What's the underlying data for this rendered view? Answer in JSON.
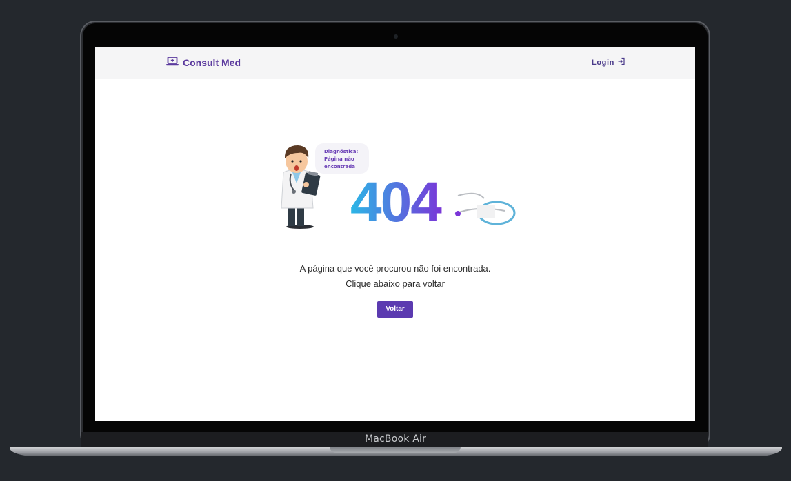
{
  "device": {
    "label": "MacBook Air"
  },
  "navbar": {
    "brand": "Consult Med",
    "login_label": "Login"
  },
  "illustration": {
    "bubble_line1": "Diagnóstica:",
    "bubble_line2": "Página não",
    "bubble_line3": "encontrada",
    "code": "404"
  },
  "main": {
    "message_line1": "A página que você procurou não foi encontrada.",
    "message_line2": "Clique abaixo para voltar",
    "back_button": "Voltar"
  },
  "colors": {
    "brand": "#5b3a9e",
    "button": "#5b3ab0",
    "gradient_start": "#2bb7e6",
    "gradient_end": "#7a35d8"
  },
  "icons": {
    "brand": "laptop-medical-icon",
    "login": "sign-in-icon"
  }
}
